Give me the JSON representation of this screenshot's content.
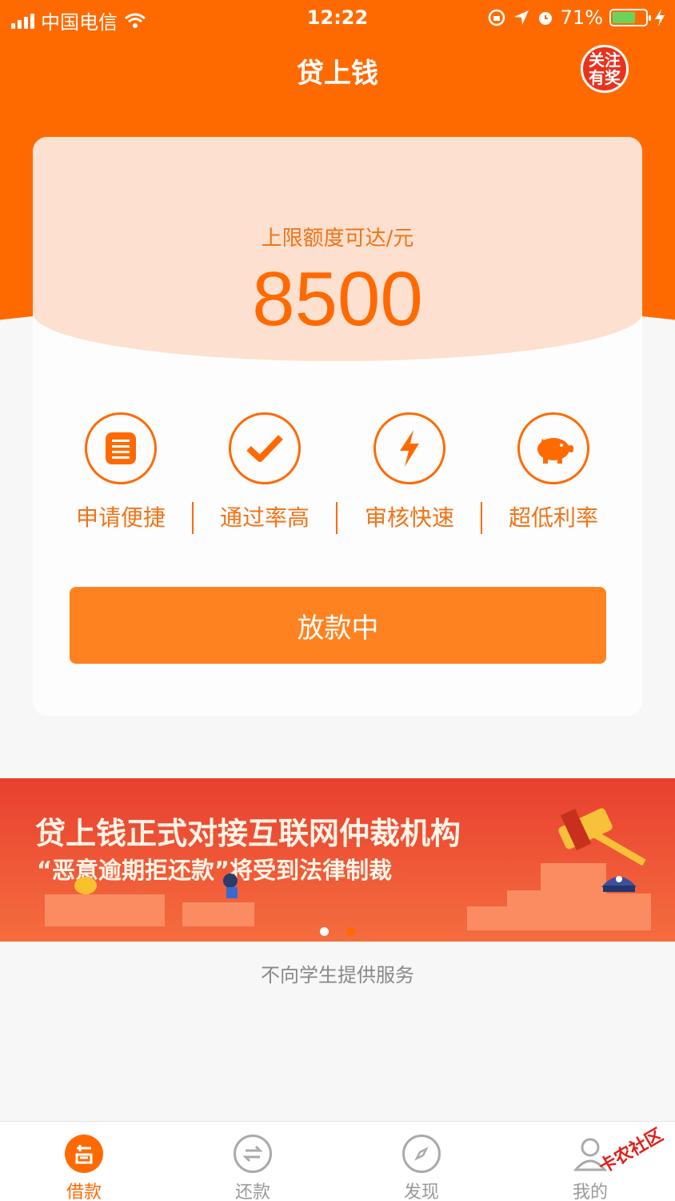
{
  "status_bar": {
    "carrier": "中国电信",
    "time": "12:22",
    "battery_percent": "71%",
    "battery_level": 0.71,
    "battery_color": "#6bd35c"
  },
  "header": {
    "title": "贷上钱",
    "follow_badge": "关注有奖",
    "accent_color": "#ff6a00"
  },
  "card": {
    "limit_label": "上限额度可达/元",
    "amount": "8500",
    "features": [
      {
        "label": "申请便捷",
        "icon": "document-icon"
      },
      {
        "label": "通过率高",
        "icon": "checkmark-icon"
      },
      {
        "label": "审核快速",
        "icon": "lightning-icon"
      },
      {
        "label": "超低利率",
        "icon": "piggy-bank-icon"
      }
    ],
    "button_label": "放款中"
  },
  "banner": {
    "line1": "贷上钱正式对接互联网仲裁机构",
    "line2": "“恶意逾期拒还款”将受到法律制裁",
    "active_slide": 1,
    "slide_count": 2
  },
  "notice": "不向学生提供服务",
  "tabbar": {
    "items": [
      {
        "label": "借款",
        "icon": "loan-icon",
        "active": true
      },
      {
        "label": "还款",
        "icon": "repay-icon",
        "active": false
      },
      {
        "label": "发现",
        "icon": "compass-icon",
        "active": false
      },
      {
        "label": "我的",
        "icon": "profile-icon",
        "active": false
      }
    ]
  },
  "watermark": "卡农社区"
}
